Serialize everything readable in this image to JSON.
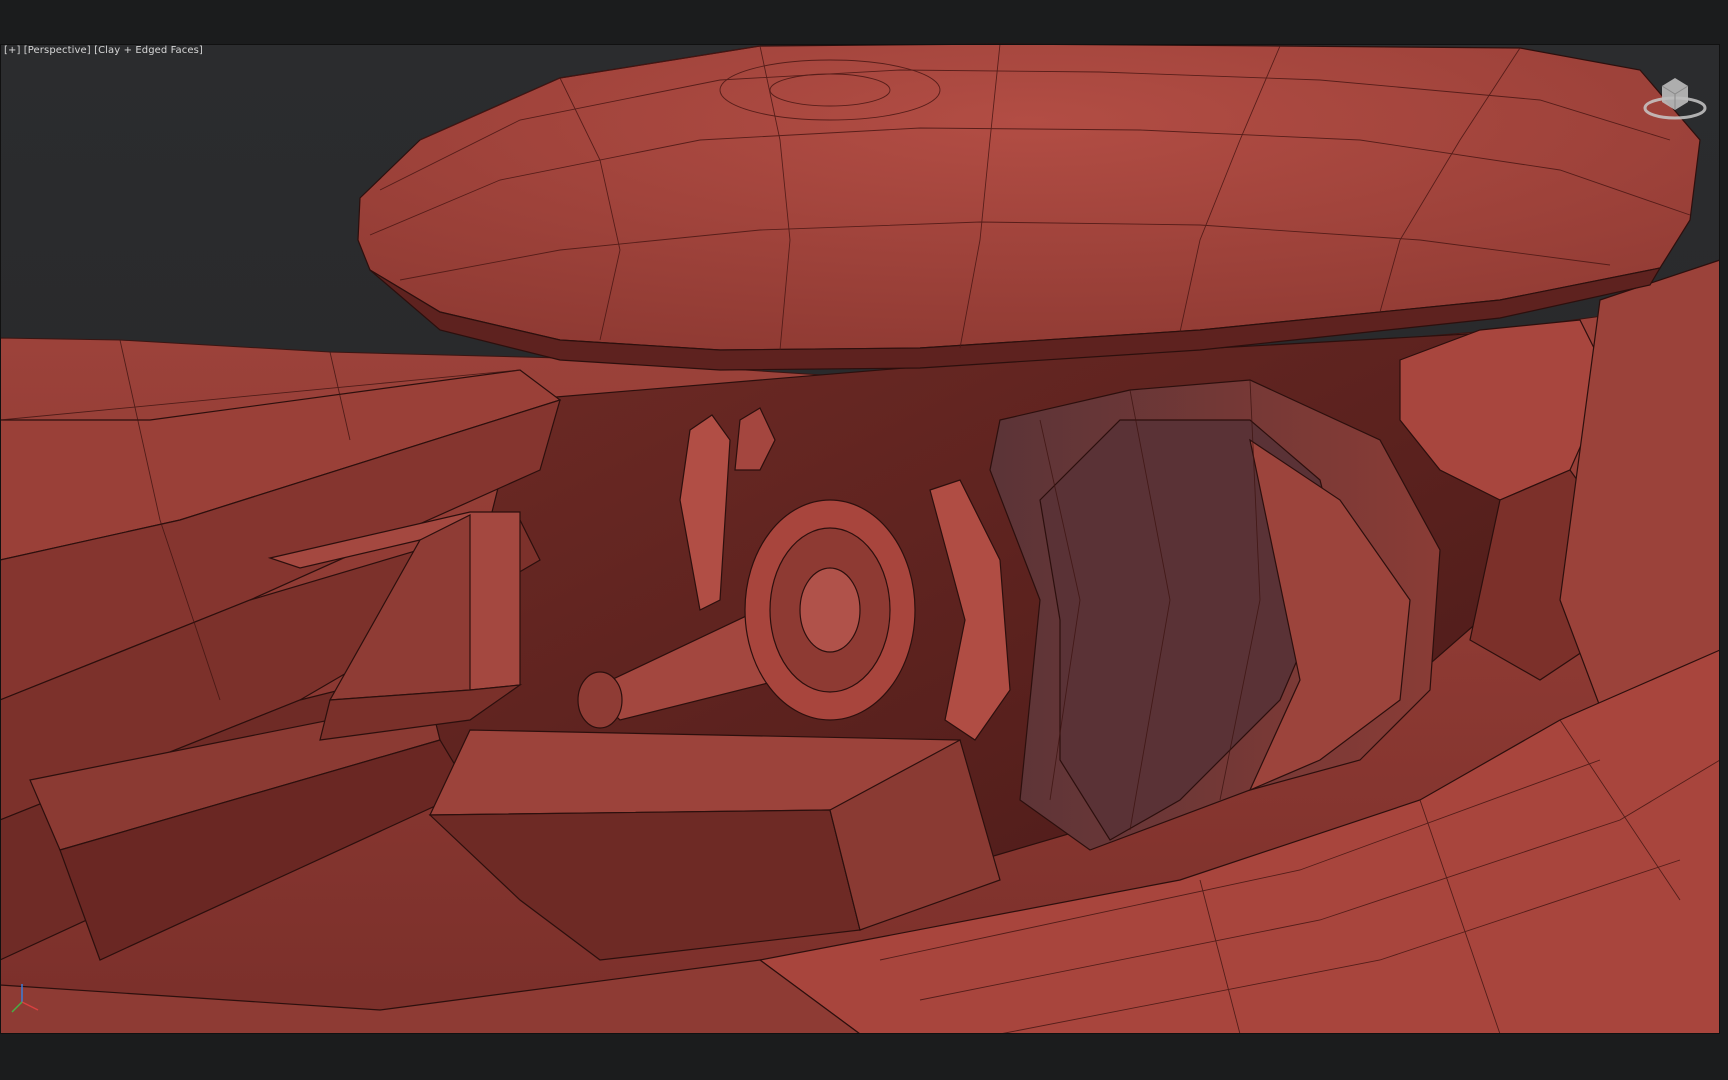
{
  "viewport": {
    "menu_label": "[+]",
    "view_label": "[Perspective]",
    "shading_label": "[Clay + Edged Faces]",
    "clay_color": "#a8443c",
    "clay_shadow": "#6a2420",
    "background": "#2a2b2d",
    "frame_color": "#1b1c1d"
  },
  "icons": {
    "viewcube": "viewcube-icon",
    "axis": "axis-tripod-icon"
  }
}
